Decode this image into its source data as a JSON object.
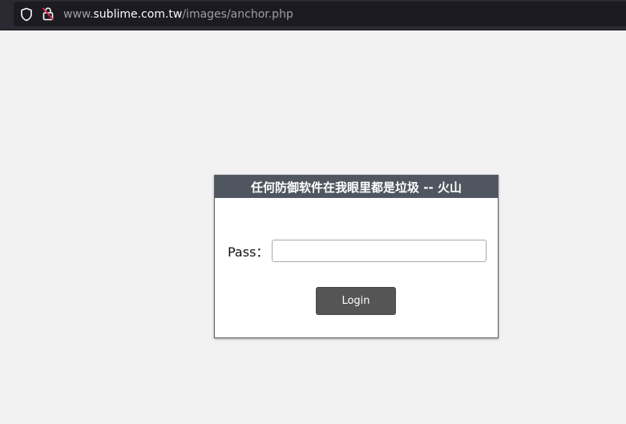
{
  "browser": {
    "url_scheme": "www.",
    "url_domain": "sublime.com.tw",
    "url_path": "/images/anchor.php",
    "icons": [
      "shield-icon",
      "lock-warning-icon"
    ]
  },
  "login": {
    "header_title": "任何防御软件在我眼里都是垃圾 -- 火山",
    "pass_label": "Pass：",
    "pass_value": "",
    "login_button_label": "Login"
  },
  "colors": {
    "browser_bar": "#2b2a33",
    "page_background": "#f2f2f2",
    "header_background": "#4f5660",
    "button_background": "#555555",
    "lock_warning": "#e22850"
  }
}
